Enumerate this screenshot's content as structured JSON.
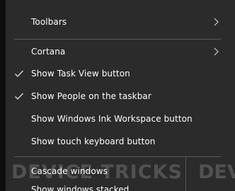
{
  "menu": {
    "items": [
      {
        "label": "Toolbars",
        "checked": false,
        "submenu": true
      },
      {
        "label": "Cortana",
        "checked": false,
        "submenu": true
      },
      {
        "label": "Show Task View button",
        "checked": true,
        "submenu": false
      },
      {
        "label": "Show People on the taskbar",
        "checked": true,
        "submenu": false
      },
      {
        "label": "Show Windows Ink Workspace button",
        "checked": false,
        "submenu": false
      },
      {
        "label": "Show touch keyboard button",
        "checked": false,
        "submenu": false
      },
      {
        "label": "Cascade windows",
        "checked": false,
        "submenu": false
      },
      {
        "label": "Show windows stacked",
        "checked": false,
        "submenu": false
      }
    ]
  },
  "watermark": {
    "text": "DEVICE TRICKS",
    "right_text": "DEV"
  },
  "colors": {
    "menu_bg": "#2b2b2b",
    "text": "#ffffff",
    "separator": "#5a5a5a"
  }
}
